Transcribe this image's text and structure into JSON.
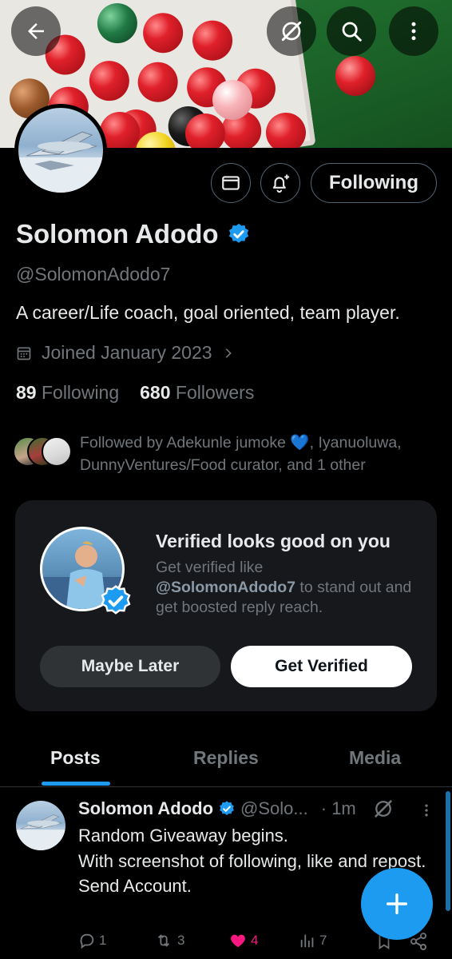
{
  "profile": {
    "name": "Solomon Adodo",
    "handle": "@SolomonAdodo7",
    "bio": "A career/Life coach, goal oriented, team player.",
    "joined": "Joined January 2023",
    "following_count": "89",
    "following_label": "Following",
    "followers_count": "680",
    "followers_label": "Followers",
    "followed_by": "Followed by Adekunle jumoke 💙, Iyanuoluwa, DunnyVentures/Food curator, and 1 other"
  },
  "header": {
    "follow_button": "Following"
  },
  "verified_card": {
    "title": "Verified looks good on you",
    "desc_prefix": "Get verified like",
    "desc_handle": "@SolomonAdodo7",
    "desc_suffix": " to stand out and get boosted reply reach.",
    "maybe_later": "Maybe Later",
    "get_verified": "Get Verified"
  },
  "tabs": [
    {
      "label": "Posts"
    },
    {
      "label": "Replies"
    },
    {
      "label": "Media"
    }
  ],
  "post": {
    "name": "Solomon Adodo",
    "handle": "@Solo...",
    "time": "· 1m",
    "text": "Random Giveaway begins.\nWith screenshot of following, like and repost.\nSend Account.",
    "replies": "1",
    "reposts": "3",
    "likes": "4",
    "views": "7"
  },
  "colors": {
    "accent": "#1d9bf0",
    "like": "#f91880",
    "muted": "#71767b"
  },
  "icons": {
    "back": "back-arrow-icon",
    "grok": "grok-icon",
    "search": "search-icon",
    "more": "more-vertical-icon",
    "message": "envelope-icon",
    "notify": "bell-plus-icon",
    "verified": "verified-badge-icon",
    "calendar": "calendar-icon",
    "compose": "plus-icon"
  }
}
